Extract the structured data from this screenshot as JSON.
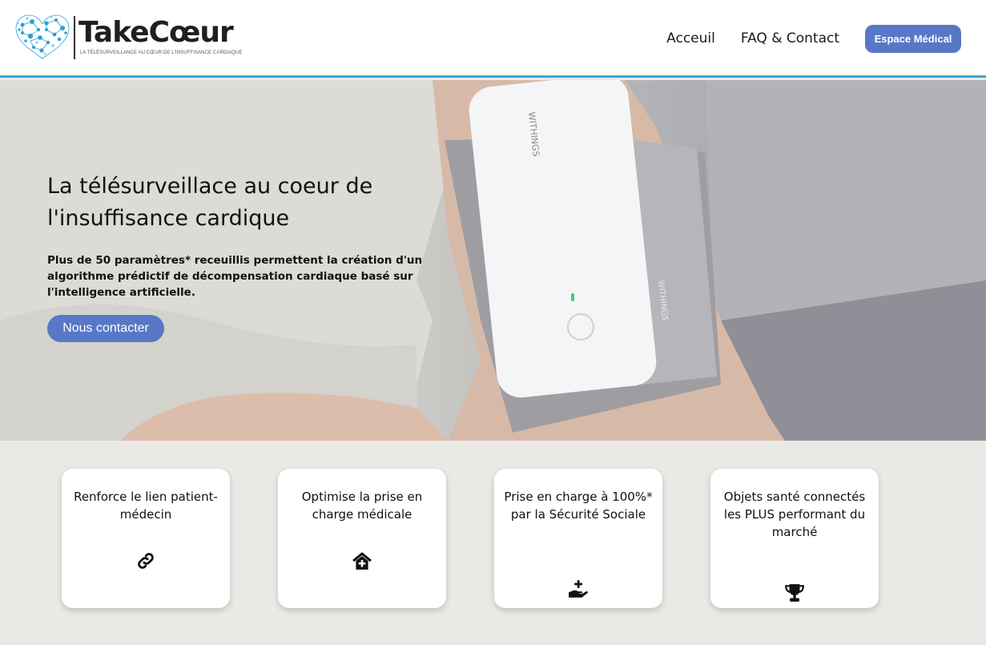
{
  "header": {
    "brand_name": "TakeCœur",
    "brand_tagline": "La télésurveillance au cœur de l'insuffisance cardiaque",
    "nav": [
      {
        "label": "Acceuil"
      },
      {
        "label": "FAQ & Contact"
      }
    ],
    "cta_label": "Espace Médical"
  },
  "hero": {
    "title_line1": "La télésurveillace au coeur de",
    "title_line2": "l'insuffisance cardique",
    "description": "Plus de 50 paramètres* receuillis permettent la création d'un algorithme prédictif de décompensation cardiaque basé sur l'intelligence artificielle.",
    "button_label": "Nous contacter",
    "device_brand": "WITHINGS"
  },
  "features": [
    {
      "text": "Renforce le lien patient-médecin",
      "icon": "link-icon"
    },
    {
      "text": "Optimise la prise en charge médicale",
      "icon": "medical-home-icon"
    },
    {
      "text": "Prise en charge à 100%* par la Sécurité Sociale",
      "icon": "hand-holding-medical-icon"
    },
    {
      "text": "Objets santé connectés les PLUS performant du marché",
      "icon": "trophy-icon"
    }
  ],
  "colors": {
    "accent": "#5778c6",
    "header_border": "#3aaad3",
    "background": "#ebe9e5"
  }
}
